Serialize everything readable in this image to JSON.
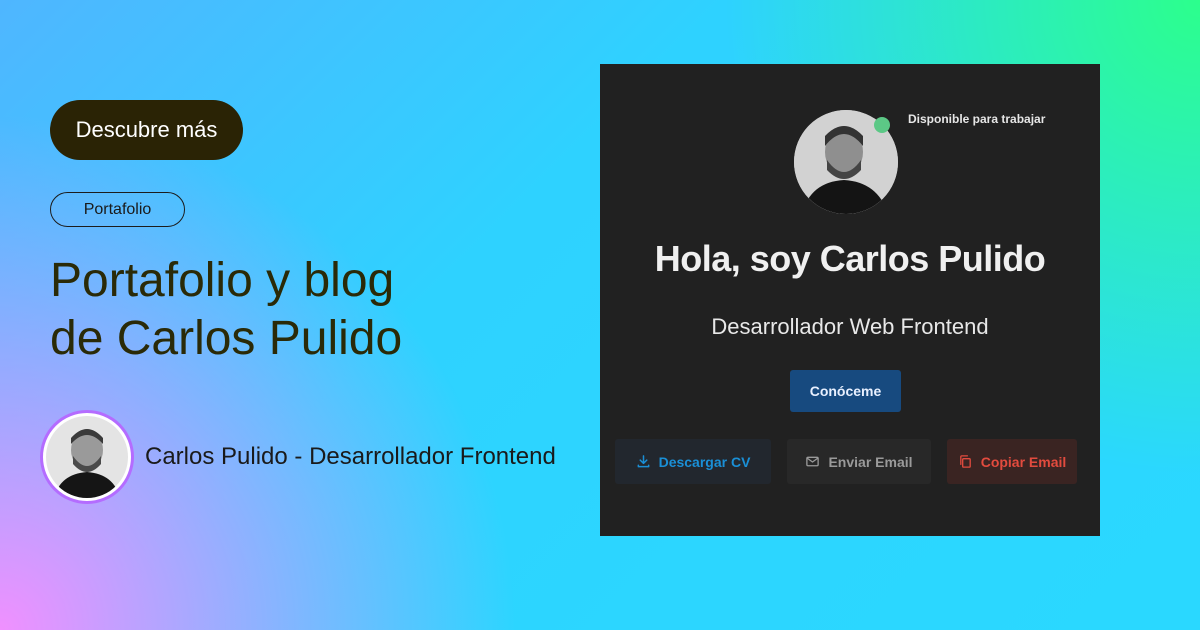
{
  "left": {
    "cta_label": "Descubre más",
    "tag_label": "Portafolio",
    "title_line1": "Portafolio y blog",
    "title_line2": "de Carlos Pulido",
    "author_name": "Carlos Pulido - Desarrollador Frontend"
  },
  "card": {
    "status_text": "Disponible para trabajar",
    "greeting": "Hola, soy Carlos Pulido",
    "role": "Desarrollador Web Frontend",
    "primary_button": "Conóceme",
    "actions": [
      {
        "label": "Descargar CV",
        "icon": "download-icon"
      },
      {
        "label": "Enviar Email",
        "icon": "mail-icon"
      },
      {
        "label": "Copiar Email",
        "icon": "copy-icon"
      }
    ]
  },
  "colors": {
    "cta_bg": "#2a2305",
    "card_bg": "#212121",
    "primary_button_bg": "#174a7f",
    "download_color": "#1a8fd6",
    "copy_color": "#e24b3e",
    "status_dot": "#5cc886"
  }
}
